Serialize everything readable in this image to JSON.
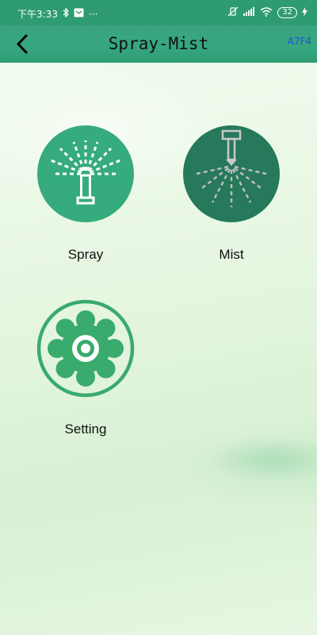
{
  "status_bar": {
    "time": "下午3:33",
    "dots": "···",
    "battery": "32"
  },
  "header": {
    "title": "Spray-Mist",
    "device_code": "A7F4"
  },
  "tiles": [
    {
      "label": "Spray",
      "icon": "sprinkler-icon",
      "color": "#36ab7d"
    },
    {
      "label": "Mist",
      "icon": "mist-nozzle-icon",
      "color": "#26795a"
    },
    {
      "label": "Setting",
      "icon": "gear-icon",
      "color": "#39ab6c"
    }
  ],
  "colors": {
    "status_bar": "#2e9b72",
    "app_bar": "#36a77f",
    "device_code": "#2050e8"
  }
}
